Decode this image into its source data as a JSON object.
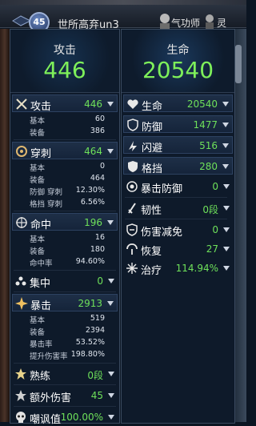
{
  "header": {
    "level": "45",
    "player_name": "世所高弃un3",
    "cultivator": "气功师",
    "spirit": "灵"
  },
  "left": {
    "hero": {
      "label": "攻击",
      "value": "446"
    },
    "attack": {
      "label": "攻击",
      "value": "446"
    },
    "attack_sub": [
      {
        "label": "基本",
        "value": "60"
      },
      {
        "label": "装备",
        "value": "386"
      }
    ],
    "pierce": {
      "label": "穿刺",
      "value": "464"
    },
    "pierce_sub": [
      {
        "label": "基本",
        "value": "0"
      },
      {
        "label": "装备",
        "value": "464"
      },
      {
        "label": "防御 穿刺",
        "value": "12.30%"
      },
      {
        "label": "格挡 穿刺",
        "value": "6.56%"
      }
    ],
    "hit": {
      "label": "命中",
      "value": "196"
    },
    "hit_sub": [
      {
        "label": "基本",
        "value": "16"
      },
      {
        "label": "装备",
        "value": "180"
      },
      {
        "label": "命中率",
        "value": "94.60%"
      }
    ],
    "focus": {
      "label": "集中",
      "value": "0"
    },
    "crit": {
      "label": "暴击",
      "value": "2913"
    },
    "crit_sub": [
      {
        "label": "基本",
        "value": "519"
      },
      {
        "label": "装备",
        "value": "2394"
      },
      {
        "label": "暴击率",
        "value": "53.52%"
      },
      {
        "label": "提升伤害率",
        "value": "198.80%"
      }
    ],
    "skill": {
      "label": "熟练",
      "value": "0段"
    },
    "extra_dmg": {
      "label": "额外伤害",
      "value": "45"
    },
    "mock": {
      "label": "嘲讽值",
      "value": "100.00%"
    }
  },
  "right": {
    "hero": {
      "label": "生命",
      "value": "20540"
    },
    "hp": {
      "label": "生命",
      "value": "20540"
    },
    "defense": {
      "label": "防御",
      "value": "1477"
    },
    "dodge": {
      "label": "闪避",
      "value": "516"
    },
    "block": {
      "label": "格挡",
      "value": "280"
    },
    "crit_def": {
      "label": "暴击防御",
      "value": "0"
    },
    "tenacity": {
      "label": "韧性",
      "value": "0段"
    },
    "dmg_reduce": {
      "label": "伤害减免",
      "value": "0"
    },
    "recovery": {
      "label": "恢复",
      "value": "27"
    },
    "healing": {
      "label": "治疗",
      "value": "114.94%"
    }
  },
  "icons": {
    "attack": "crossed-swords-icon",
    "pierce": "pierce-icon",
    "hit": "target-icon",
    "focus": "focus-icon",
    "crit": "burst-icon",
    "skill": "star-icon",
    "extra_dmg": "power-icon",
    "mock": "skull-icon",
    "hp": "heart-icon",
    "defense": "shield-icon",
    "dodge": "dodge-icon",
    "block": "block-icon",
    "crit_def": "crit-defense-icon",
    "tenacity": "tenacity-icon",
    "dmg_reduce": "damage-reduction-icon",
    "recovery": "recovery-icon",
    "healing": "healing-icon"
  },
  "colors": {
    "value_green": "#6ee05a",
    "hero_green": "#7ef05a",
    "panel_bg": "#0e1a2a",
    "highlight_row": "#1e2f47"
  }
}
